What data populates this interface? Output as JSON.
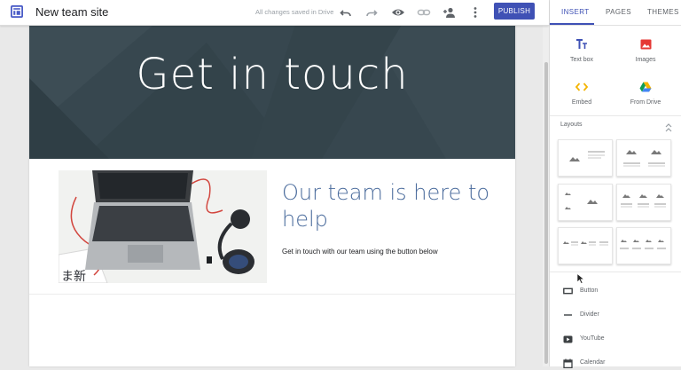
{
  "app": {
    "site_title": "New team site",
    "save_status": "All changes saved in Drive",
    "publish_label": "PUBLISH"
  },
  "toolbar_icons": [
    "undo-icon",
    "redo-icon",
    "preview-icon",
    "link-icon",
    "share-icon",
    "more-vert-icon"
  ],
  "page": {
    "header_title": "Get in touch",
    "section_heading": "Our team is here to help",
    "section_body": "Get in touch with our team using the button below",
    "photo_caption_chars": "ま新"
  },
  "panel": {
    "tabs": [
      {
        "label": "INSERT",
        "active": true
      },
      {
        "label": "PAGES",
        "active": false
      },
      {
        "label": "THEMES",
        "active": false
      }
    ],
    "insert_tiles": [
      {
        "label": "Text box",
        "icon": "text-box-icon"
      },
      {
        "label": "Images",
        "icon": "image-icon"
      },
      {
        "label": "Embed",
        "icon": "embed-icon"
      },
      {
        "label": "From Drive",
        "icon": "drive-icon"
      }
    ],
    "layouts_label": "Layouts",
    "items": [
      {
        "label": "Button",
        "icon": "button-icon"
      },
      {
        "label": "Divider",
        "icon": "divider-icon"
      },
      {
        "label": "YouTube",
        "icon": "youtube-icon"
      },
      {
        "label": "Calendar",
        "icon": "calendar-icon"
      }
    ]
  },
  "colors": {
    "accent": "#3f51b5",
    "header_bg": "#37474f",
    "heading_text": "#4a6b9c"
  }
}
